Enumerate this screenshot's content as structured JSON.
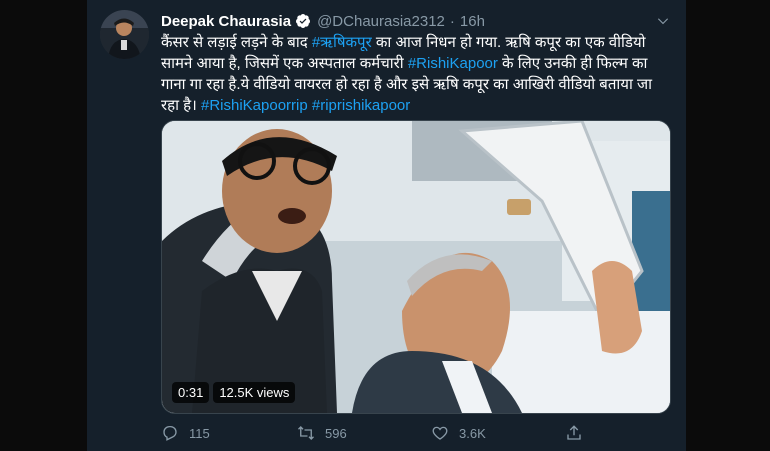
{
  "tweet": {
    "author_name": "Deepak Chaurasia",
    "author_handle": "@DChaurasia2312",
    "separator": "·",
    "time": "16h",
    "text": {
      "part1": "कैंसर से लड़ाई लड़ने के बाद ",
      "hashtag1": "#ऋषिकपूर",
      "part2": " का आज निधन हो गया. ऋषि कपूर का एक वीडियो सामने आया है, जिसमें एक अस्पताल कर्मचारी ",
      "hashtag2": "#RishiKapoor",
      "part3": " के लिए उनकी ही फिल्म का गाना गा रहा है.ये वीडियो वायरल हो रहा है और इसे ऋषि कपूर का आखिरी वीडियो बताया जा रहा है। ",
      "hashtag3": "#RishiKapoorrip",
      "space": " ",
      "hashtag4": "#riprishikapoor"
    },
    "video": {
      "duration": "0:31",
      "views": "12.5K views"
    },
    "actions": {
      "reply_count": "115",
      "retweet_count": "596",
      "like_count": "3.6K"
    }
  },
  "icons": {
    "verified": "verified-badge-icon",
    "more": "chevron-down-icon",
    "reply": "reply-icon",
    "retweet": "retweet-icon",
    "like": "heart-icon",
    "share": "share-icon"
  },
  "colors": {
    "background": "#15202b",
    "link": "#1da1f2",
    "muted": "#8899a6",
    "text": "#ffffff"
  }
}
